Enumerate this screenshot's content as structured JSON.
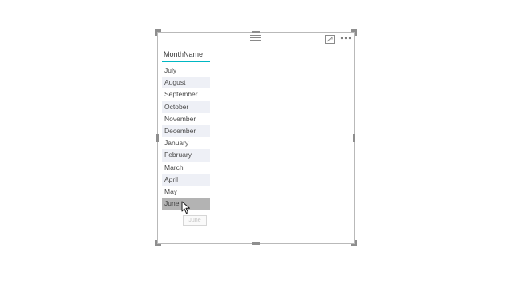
{
  "slicer": {
    "header": "MonthName",
    "items": [
      {
        "label": "July",
        "style": "plain"
      },
      {
        "label": "August",
        "style": "alt"
      },
      {
        "label": "September",
        "style": "plain"
      },
      {
        "label": "October",
        "style": "alt"
      },
      {
        "label": "November",
        "style": "plain"
      },
      {
        "label": "December",
        "style": "alt"
      },
      {
        "label": "January",
        "style": "plain"
      },
      {
        "label": "February",
        "style": "alt"
      },
      {
        "label": "March",
        "style": "plain"
      },
      {
        "label": "April",
        "style": "alt"
      },
      {
        "label": "May",
        "style": "plain"
      },
      {
        "label": "June",
        "style": "selected"
      }
    ],
    "selected_item": "June"
  },
  "tooltip": {
    "text": "June"
  },
  "icons": {
    "grip": "drag-grip-icon",
    "focus": "focus-mode-icon",
    "more": "more-options-icon",
    "cursor": "mouse-pointer-icon"
  },
  "colors": {
    "accent": "#00b7c3",
    "selected_row": "#b3b3b3",
    "alt_row": "#eef0f6",
    "frame": "#b9b9b9"
  }
}
